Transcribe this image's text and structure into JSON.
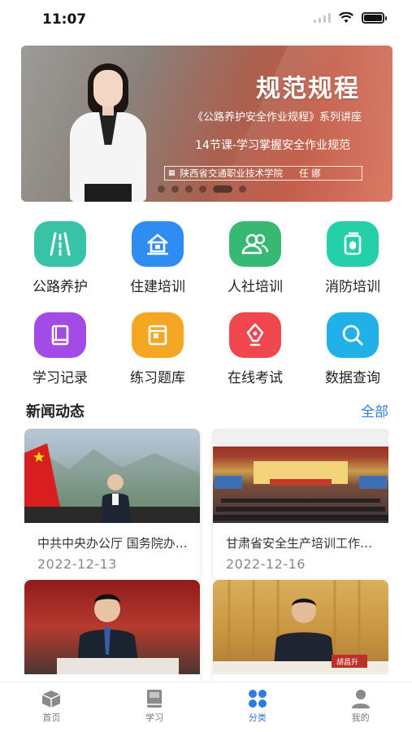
{
  "status_bar": {
    "time": "11:07"
  },
  "banner": {
    "title": "规范规程",
    "subtitle": "《公路养护安全作业规程》系列讲座",
    "lesson": "14节课-学习掌握安全作业规范",
    "footer_school": "陕西省交通职业技术学院",
    "footer_speaker": "任 娜",
    "slide_count": 6,
    "active_slide": 5
  },
  "categories": [
    {
      "label": "公路养护",
      "icon": "road-icon",
      "color": "#39c3a6"
    },
    {
      "label": "住建培训",
      "icon": "house-icon",
      "color": "#2f8cf0"
    },
    {
      "label": "人社培训",
      "icon": "people-icon",
      "color": "#37b873"
    },
    {
      "label": "消防培训",
      "icon": "fire-shield-icon",
      "color": "#25d0a8"
    },
    {
      "label": "学习记录",
      "icon": "book-icon",
      "color": "#a34be6"
    },
    {
      "label": "练习题库",
      "icon": "question-bank-icon",
      "color": "#f5a623"
    },
    {
      "label": "在线考试",
      "icon": "pen-icon",
      "color": "#f0474f"
    },
    {
      "label": "数据查询",
      "icon": "search-icon",
      "color": "#21b1e8"
    }
  ],
  "news": {
    "title": "新闻动态",
    "more": "全部",
    "items": [
      {
        "title": "中共中央办公厅 国务院办公厅",
        "date": "2022-12-13"
      },
      {
        "title": "甘肃省安全生产培训工作会议",
        "date": "2022-12-16"
      },
      {
        "title": "",
        "date": ""
      },
      {
        "title": "",
        "date": ""
      }
    ]
  },
  "image_captions": {
    "news4_nameplate": "胡昌升"
  },
  "tabbar": {
    "items": [
      {
        "label": "首页",
        "icon": "box-icon",
        "active": false
      },
      {
        "label": "学习",
        "icon": "notebook-icon",
        "active": false
      },
      {
        "label": "分类",
        "icon": "grid-icon",
        "active": true
      },
      {
        "label": "我的",
        "icon": "user-icon",
        "active": false
      }
    ]
  },
  "colors": {
    "accent": "#2f7be0",
    "inactive": "#777777"
  }
}
